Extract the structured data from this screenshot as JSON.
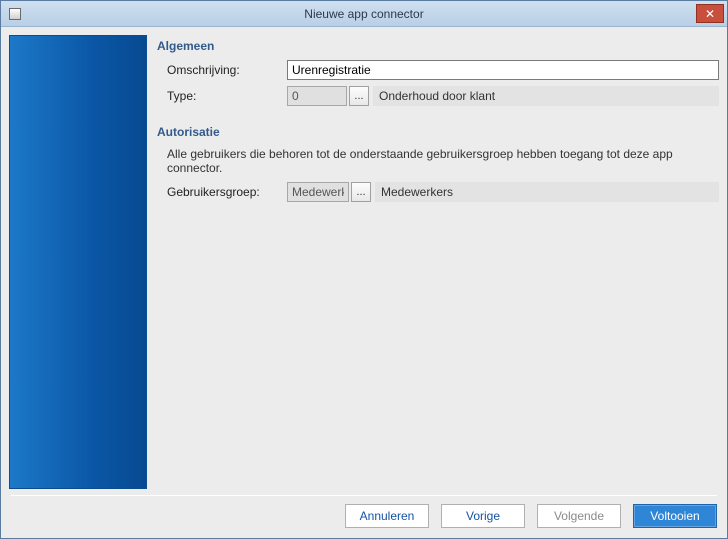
{
  "window": {
    "title": "Nieuwe app connector"
  },
  "sections": {
    "general": {
      "title": "Algemeen",
      "description_label": "Omschrijving:",
      "description_value": "Urenregistratie",
      "type_label": "Type:",
      "type_value": "0",
      "type_readout": "Onderhoud door klant",
      "ellipsis": "..."
    },
    "auth": {
      "title": "Autorisatie",
      "help": "Alle gebruikers die behoren tot de onderstaande gebruikersgroep hebben toegang tot deze app connector.",
      "group_label": "Gebruikersgroep:",
      "group_value": "Medewerkers",
      "group_readout": "Medewerkers",
      "ellipsis": "..."
    }
  },
  "buttons": {
    "cancel": "Annuleren",
    "back": "Vorige",
    "next": "Volgende",
    "finish": "Voltooien"
  }
}
